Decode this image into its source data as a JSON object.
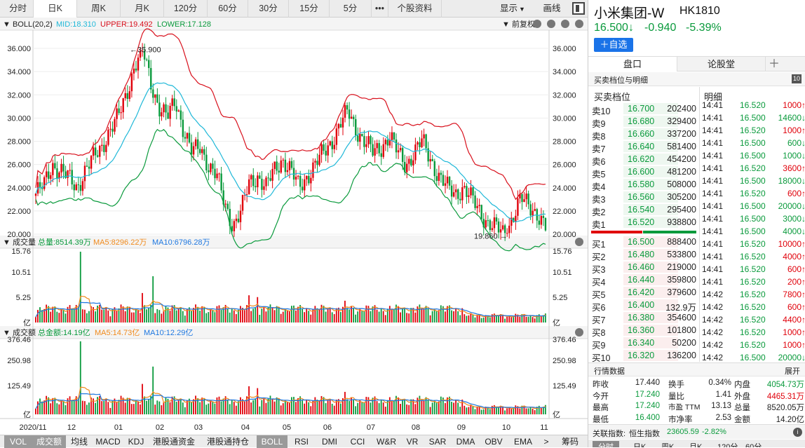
{
  "period_tabs": [
    "分时",
    "日K",
    "周K",
    "月K",
    "120分",
    "60分",
    "30分",
    "15分",
    "5分",
    "•••",
    "个股资料"
  ],
  "active_period": 1,
  "top_right": {
    "display": "显示",
    "draw": "画线"
  },
  "boll": {
    "label": "BOLL(20,2)",
    "mid": "MID:18.310",
    "upper": "UPPER:19.492",
    "lower": "LOWER:17.128",
    "adjust": "前复权"
  },
  "price_axis": [
    "36.000",
    "34.000",
    "32.000",
    "30.000",
    "28.000",
    "26.000",
    "24.000",
    "22.000",
    "20.000"
  ],
  "max_label": "35.900",
  "min_label": "19.860",
  "volume": {
    "title": "成交量",
    "total": "总量:8514.39万",
    "ma5": "MA5:8296.22万",
    "ma10": "MA10:6796.28万",
    "axis": [
      "15.76",
      "10.51",
      "5.25",
      "亿"
    ]
  },
  "amount": {
    "title": "成交额",
    "total": "总金额:14.19亿",
    "ma5": "MA5:14.73亿",
    "ma10": "MA10:12.29亿",
    "axis": [
      "376.46",
      "250.98",
      "125.49",
      "亿"
    ]
  },
  "x_labels": [
    "2020/11",
    "12",
    "01",
    "02",
    "03",
    "04",
    "05",
    "06",
    "07",
    "08",
    "09",
    "10",
    "11"
  ],
  "indicators": [
    "VOL",
    "成交额",
    "均线",
    "MACD",
    "KDJ",
    "港股通资金",
    "港股通持仓",
    "BOLL",
    "RSI",
    "DMI",
    "CCI",
    "W&R",
    "VR",
    "SAR",
    "DMA",
    "OBV",
    "EMA",
    ">",
    "筹码"
  ],
  "active_indicators": [
    0,
    1,
    7
  ],
  "stock": {
    "name": "小米集团-W",
    "code": "HK1810",
    "price": "16.500↓",
    "change": "-0.940",
    "pct": "-5.39%",
    "add_watch": "＋自选"
  },
  "side_tabs": [
    "盘口",
    "论股堂",
    "＋"
  ],
  "section_title": "买卖档位与明细",
  "section_badge": "10",
  "order_title": "买卖档位",
  "detail_title": "明细",
  "asks": [
    {
      "label": "卖10",
      "price": "16.700",
      "vol": "202400"
    },
    {
      "label": "卖9",
      "price": "16.680",
      "vol": "329400"
    },
    {
      "label": "卖8",
      "price": "16.660",
      "vol": "337200"
    },
    {
      "label": "卖7",
      "price": "16.640",
      "vol": "581400"
    },
    {
      "label": "卖6",
      "price": "16.620",
      "vol": "454200"
    },
    {
      "label": "卖5",
      "price": "16.600",
      "vol": "481200"
    },
    {
      "label": "卖4",
      "price": "16.580",
      "vol": "508000"
    },
    {
      "label": "卖3",
      "price": "16.560",
      "vol": "305200"
    },
    {
      "label": "卖2",
      "price": "16.540",
      "vol": "295400"
    },
    {
      "label": "卖1",
      "price": "16.520",
      "vol": "938800"
    }
  ],
  "bids": [
    {
      "label": "买1",
      "price": "16.500",
      "vol": "888400"
    },
    {
      "label": "买2",
      "price": "16.480",
      "vol": "533800"
    },
    {
      "label": "买3",
      "price": "16.460",
      "vol": "219000"
    },
    {
      "label": "买4",
      "price": "16.440",
      "vol": "359800"
    },
    {
      "label": "买5",
      "price": "16.420",
      "vol": "379600"
    },
    {
      "label": "买6",
      "price": "16.400",
      "vol": "132.9万"
    },
    {
      "label": "买7",
      "price": "16.380",
      "vol": "354600"
    },
    {
      "label": "买8",
      "price": "16.360",
      "vol": "101800"
    },
    {
      "label": "买9",
      "price": "16.340",
      "vol": "50200"
    },
    {
      "label": "买10",
      "price": "16.320",
      "vol": "136200"
    }
  ],
  "ticks": [
    {
      "t": "14:41",
      "p": "16.520",
      "v": "1000↑",
      "c": "red"
    },
    {
      "t": "14:41",
      "p": "16.500",
      "v": "14600↓",
      "c": "green"
    },
    {
      "t": "14:41",
      "p": "16.520",
      "v": "1000↑",
      "c": "red"
    },
    {
      "t": "14:41",
      "p": "16.500",
      "v": "600↓",
      "c": "green"
    },
    {
      "t": "14:41",
      "p": "16.500",
      "v": "1000↓",
      "c": "green"
    },
    {
      "t": "14:41",
      "p": "16.520",
      "v": "3600↑",
      "c": "red"
    },
    {
      "t": "14:41",
      "p": "16.500",
      "v": "18000↓",
      "c": "green"
    },
    {
      "t": "14:41",
      "p": "16.520",
      "v": "600↑",
      "c": "red"
    },
    {
      "t": "14:41",
      "p": "16.500",
      "v": "20000↓",
      "c": "green"
    },
    {
      "t": "14:41",
      "p": "16.500",
      "v": "3000↓",
      "c": "green"
    },
    {
      "t": "14:41",
      "p": "16.500",
      "v": "4000↓",
      "c": "green"
    },
    {
      "t": "14:41",
      "p": "16.520",
      "v": "10000↑",
      "c": "red"
    },
    {
      "t": "14:41",
      "p": "16.520",
      "v": "4000↑",
      "c": "red"
    },
    {
      "t": "14:41",
      "p": "16.520",
      "v": "600↑",
      "c": "red"
    },
    {
      "t": "14:41",
      "p": "16.520",
      "v": "200↑",
      "c": "red"
    },
    {
      "t": "14:42",
      "p": "16.520",
      "v": "7800↑",
      "c": "red"
    },
    {
      "t": "14:42",
      "p": "16.520",
      "v": "600↑",
      "c": "red"
    },
    {
      "t": "14:42",
      "p": "16.520",
      "v": "4400↑",
      "c": "red"
    },
    {
      "t": "14:42",
      "p": "16.520",
      "v": "1000↑",
      "c": "red"
    },
    {
      "t": "14:42",
      "p": "16.520",
      "v": "1000↑",
      "c": "red"
    },
    {
      "t": "14:42",
      "p": "16.500",
      "v": "20000↓",
      "c": "green"
    }
  ],
  "market": {
    "title": "行情数据",
    "expand": "展开",
    "rows": [
      [
        {
          "k": "昨收",
          "v": "17.440",
          "c": "black"
        },
        {
          "k": "换手",
          "v": "0.34%",
          "c": "black"
        },
        {
          "k": "内盘",
          "v": "4054.73万",
          "c": "green"
        }
      ],
      [
        {
          "k": "今开",
          "v": "17.240",
          "c": "green"
        },
        {
          "k": "量比",
          "v": "1.41",
          "c": "black"
        },
        {
          "k": "外盘",
          "v": "4465.31万",
          "c": "red"
        }
      ],
      [
        {
          "k": "最高",
          "v": "17.240",
          "c": "green"
        },
        {
          "k": "市盈 TTM",
          "v": "13.13",
          "c": "black"
        },
        {
          "k": "总量",
          "v": "8520.05万",
          "c": "black"
        }
      ],
      [
        {
          "k": "最低",
          "v": "16.400",
          "c": "green"
        },
        {
          "k": "市净率",
          "v": "2.53",
          "c": "black"
        },
        {
          "k": "金额",
          "v": "14.20亿",
          "c": "black"
        }
      ]
    ]
  },
  "index_bar": {
    "label": "关联指数:",
    "name": "恒生指数",
    "value": "23605.59",
    "pct": "-2.82%"
  },
  "bottom_tabs": [
    "分时",
    "日K",
    "周K",
    "月K",
    "120分",
    "60分"
  ],
  "colors": {
    "up": "#e0000a",
    "down": "#0a9a3c",
    "mid": "#1fb8d8",
    "upper": "#d8101c",
    "lower": "#0a9a3c",
    "ma5": "#f08a1c",
    "ma10": "#1f78e0",
    "accent": "#1a73e8"
  },
  "chart_data": {
    "type": "candlestick",
    "price_range": [
      19.86,
      35.9
    ],
    "y_ticks": [
      20,
      22,
      24,
      26,
      28,
      30,
      32,
      34,
      36
    ],
    "series_desc": "daily OHLC 2020/11 – 2021/11 with BOLL(20,2) bands, volume and turnover sub-panels",
    "x_months": [
      "2020/11",
      "12",
      "01",
      "02",
      "03",
      "04",
      "05",
      "06",
      "07",
      "08",
      "09",
      "10",
      "11"
    ],
    "close_path": [
      23.5,
      24.2,
      26.0,
      25.5,
      24.8,
      24.0,
      25.5,
      26.5,
      27.5,
      29.0,
      30.0,
      32.0,
      34.5,
      35.9,
      33.0,
      31.0,
      30.0,
      31.5,
      29.0,
      27.0,
      27.5,
      26.0,
      25.0,
      22.5,
      20.8,
      22.0,
      24.5,
      25.0,
      24.0,
      25.5,
      26.5,
      25.5,
      24.0,
      25.0,
      26.0,
      27.0,
      28.0,
      29.5,
      30.5,
      29.0,
      28.0,
      27.0,
      27.5,
      28.5,
      27.0,
      26.0,
      27.0,
      28.0,
      26.5,
      25.0,
      24.0,
      23.5,
      24.0,
      23.0,
      22.0,
      21.0,
      20.5,
      20.0,
      21.5,
      23.0,
      22.5,
      21.8,
      20.5
    ]
  }
}
